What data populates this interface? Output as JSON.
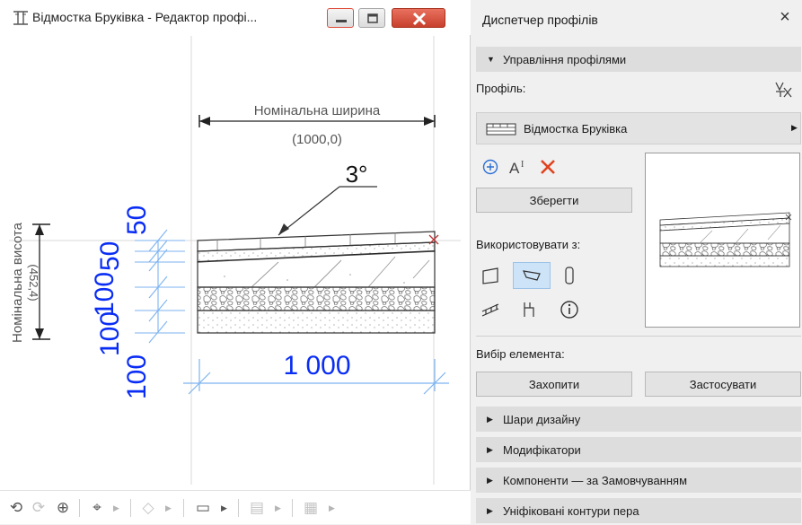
{
  "editor": {
    "title": "Відмостка Бруківка - Редактор профі...",
    "drawing": {
      "nominal_width_label": "Номінальна ширина",
      "nominal_width_value": "(1000,0)",
      "nominal_height_label": "Номінальна висота",
      "nominal_height_value": "(452,4)",
      "slope_label": "3°",
      "width_dim": "1 000",
      "layer_dims": [
        "50",
        "50",
        "100",
        "100",
        "100"
      ],
      "accent_color": "#0a2df5"
    },
    "toolbar": {
      "icons": [
        "rotate-icon",
        "redo-icon",
        "zoom-in-icon",
        "zoom-fit-icon",
        "transform-icon",
        "ruler-icon",
        "layers-icon",
        "grid-icon"
      ]
    }
  },
  "panel": {
    "title": "Диспетчер профілів",
    "close_symbol": "×",
    "manage_section": "Управління профілями",
    "profile_label": "Профіль:",
    "profile_name": "Відмостка Бруківка",
    "save_button": "Зберегти",
    "use_with_label": "Використовувати з:",
    "element_selection_label": "Вибір елемента:",
    "capture_button": "Захопити",
    "apply_button": "Застосувати",
    "collapsed_sections": [
      "Шари дизайну",
      "Модифікатори",
      "Компоненти — за Замовчуванням",
      "Уніфіковані контури пера"
    ]
  }
}
